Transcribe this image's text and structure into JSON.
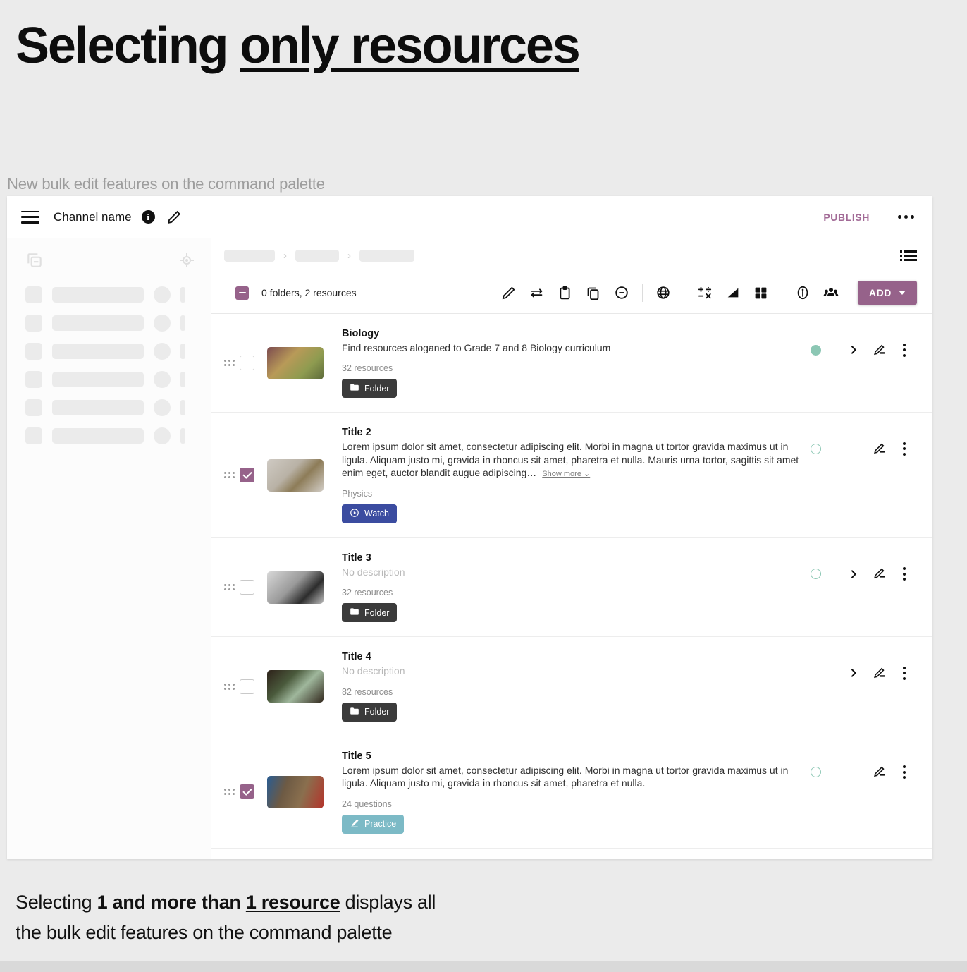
{
  "headline": {
    "prefix": "Selecting ",
    "underlined": "only resources"
  },
  "sub_caption": "New bulk edit features on the command palette",
  "topbar": {
    "menu_icon": "hamburger-icon",
    "channel_name": "Channel name",
    "info_icon": "info-badge-icon",
    "edit_icon": "pencil-icon",
    "publish_label": "PUBLISH",
    "more_icon": "more-horizontal-icon"
  },
  "sidebar": {
    "copy_icon": "copy-minus-icon",
    "target_icon": "crosshair-icon",
    "skeleton_rows": 6
  },
  "breadcrumb": {
    "separator": "›",
    "placeholder_count": 3
  },
  "viewtoggle": {
    "icon": "list-view-icon"
  },
  "command_palette": {
    "select_state": "indeterminate",
    "count_label": "0 folders, 2 resources",
    "tools": [
      {
        "name": "edit-icon",
        "label": "Edit"
      },
      {
        "name": "move-icon",
        "label": "Move"
      },
      {
        "name": "clipboard-icon",
        "label": "Paste"
      },
      {
        "name": "duplicate-icon",
        "label": "Duplicate"
      },
      {
        "name": "remove-icon",
        "label": "Remove"
      },
      {
        "name": "globe-icon",
        "label": "Language"
      },
      {
        "name": "math-operators-icon",
        "label": "Subject"
      },
      {
        "name": "level-bars-icon",
        "label": "Level"
      },
      {
        "name": "grid-category-icon",
        "label": "Category"
      },
      {
        "name": "accessibility-icon",
        "label": "Accessibility"
      },
      {
        "name": "audience-icon",
        "label": "Audience"
      }
    ],
    "add_label": "ADD"
  },
  "rows": [
    {
      "title": "Biology",
      "description": "Find resources aloganed to Grade 7 and 8 Biology curriculum",
      "desc_empty": false,
      "meta": "32 resources",
      "badge": {
        "label": "Folder",
        "kind": "folder",
        "icon": "folder-icon"
      },
      "checked": false,
      "status": "filled",
      "has_chevron": true,
      "show_more": null,
      "thumb": "linear-gradient(135deg,#7c4b4f 0%,#b89a58 38%,#8e9b50 70%,#5d6b3a 100%)"
    },
    {
      "title": "Title 2",
      "description": "Lorem ipsum dolor sit amet, consectetur adipiscing elit. Morbi in magna ut tortor gravida maximus ut in ligula. Aliquam justo mi, gravida in rhoncus sit amet, pharetra et nulla. Mauris urna tortor, sagittis sit amet enim eget, auctor blandit augue adipiscing…",
      "desc_empty": false,
      "meta": "Physics",
      "badge": {
        "label": "Watch",
        "kind": "watch",
        "icon": "play-circle-icon"
      },
      "checked": true,
      "status": "hollow",
      "has_chevron": false,
      "show_more": "Show more",
      "thumb": "linear-gradient(135deg,#cfcac3 0%,#b9b2a6 40%,#8d7c58 62%,#d2cdc6 100%)"
    },
    {
      "title": "Title 3",
      "description": "No description",
      "desc_empty": true,
      "meta": "32 resources",
      "badge": {
        "label": "Folder",
        "kind": "folder",
        "icon": "folder-icon"
      },
      "checked": false,
      "status": "hollow",
      "has_chevron": true,
      "show_more": null,
      "thumb": "linear-gradient(135deg,#d8d8d8 0%,#9a9a9a 45%,#2c2c2c 72%,#bdbdbd 100%)"
    },
    {
      "title": "Title 4",
      "description": "No description",
      "desc_empty": true,
      "meta": "82 resources",
      "badge": {
        "label": "Folder",
        "kind": "folder",
        "icon": "folder-icon"
      },
      "checked": false,
      "status": "none",
      "has_chevron": true,
      "show_more": null,
      "thumb": "linear-gradient(135deg,#2d2119 0%,#4a5a3c 35%,#9fb79c 60%,#33291e 100%)"
    },
    {
      "title": "Title 5",
      "description": "Lorem ipsum dolor sit amet, consectetur adipiscing elit. Morbi in magna ut tortor gravida maximus ut in ligula. Aliquam justo mi, gravida in rhoncus sit amet, pharetra et nulla.",
      "desc_empty": false,
      "meta": "24 questions",
      "badge": {
        "label": "Practice",
        "kind": "practice",
        "icon": "practice-icon"
      },
      "checked": true,
      "status": "hollow",
      "has_chevron": false,
      "show_more": null,
      "thumb": "linear-gradient(110deg,#2a5c92 0%,#6d5a44 32%,#8a6f4e 62%,#b0392e 97%)"
    }
  ],
  "row_actions": {
    "chevron_icon": "chevron-right-icon",
    "edit_icon": "pencil-edit-icon",
    "more_icon": "more-vertical-icon"
  },
  "bottom_caption": {
    "part1": "Selecting ",
    "bold1": "1 and more than ",
    "bold_underline": "1 resource",
    "part2": " displays all",
    "line2": "the bulk edit features on the command palette"
  },
  "colors": {
    "accent": "#96628a",
    "status_green": "#8cc7b4",
    "watch_blue": "#3b4ca0",
    "practice_teal": "#7cbac6",
    "folder_dark": "#3b3b3b"
  }
}
